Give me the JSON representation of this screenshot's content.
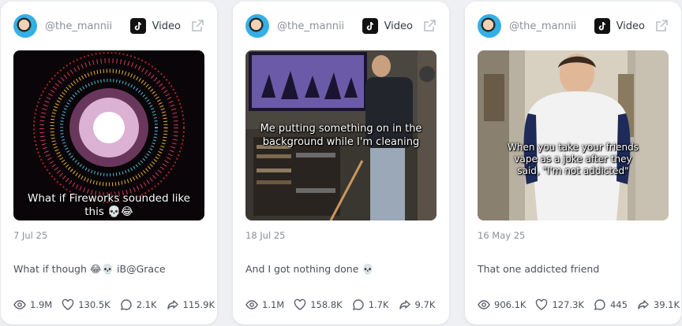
{
  "cards": [
    {
      "handle": "@the_mannii",
      "platform": "Video",
      "overlay_text": "What if Fireworks sounded like this 💀😂",
      "date": "7 Jul 25",
      "caption": "What if though 😂💀 iB@Grace",
      "stats": {
        "views": "1.9M",
        "likes": "130.5K",
        "comments": "2.1K",
        "shares": "115.9K"
      }
    },
    {
      "handle": "@the_mannii",
      "platform": "Video",
      "overlay_text": "Me putting something on in the background while I'm cleaning",
      "date": "18 Jul 25",
      "caption": "And I got nothing done 💀",
      "stats": {
        "views": "1.1M",
        "likes": "158.8K",
        "comments": "1.7K",
        "shares": "9.7K"
      }
    },
    {
      "handle": "@the_mannii",
      "platform": "Video",
      "overlay_text": "When you take your friends vape as a joke after they said, \"I'm not addicted\"",
      "date": "16 May 25",
      "caption": "That one addicted friend",
      "stats": {
        "views": "906.1K",
        "likes": "127.3K",
        "comments": "445",
        "shares": "39.1K"
      }
    }
  ],
  "icons": {
    "platform": "tiktok-icon",
    "external": "external-link-icon",
    "views": "eye-icon",
    "likes": "heart-icon",
    "comments": "comment-icon",
    "shares": "share-icon"
  }
}
